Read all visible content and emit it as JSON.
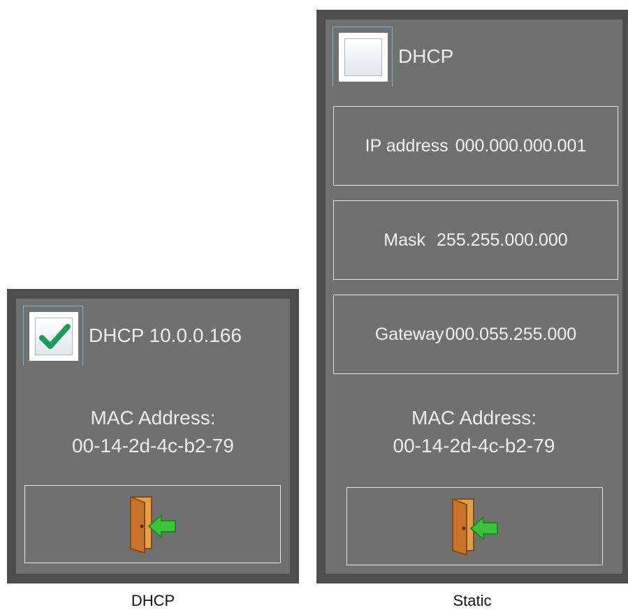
{
  "dhcp_panel": {
    "checkbox_checked": true,
    "checkbox_label": "DHCP 10.0.0.166",
    "mac_label": "MAC Address:",
    "mac_value": "00-14-2d-4c-b2-79",
    "exit_icon": "exit-door-arrow-icon",
    "caption": "DHCP"
  },
  "static_panel": {
    "checkbox_checked": false,
    "checkbox_label": "DHCP",
    "fields": [
      {
        "label": "IP address",
        "value": "000.000.000.001"
      },
      {
        "label": "Mask",
        "value": "255.255.000.000"
      },
      {
        "label": "Gateway",
        "value": "000.055.255.000"
      }
    ],
    "mac_label": "MAC Address:",
    "mac_value": "00-14-2d-4c-b2-79",
    "exit_icon": "exit-door-arrow-icon",
    "caption": "Static"
  },
  "colors": {
    "frame": "#4d4d4d",
    "panel": "#707070",
    "checkmark": "#1e9a5c",
    "arrow": "#3cc23c",
    "door": "#c8742a"
  }
}
